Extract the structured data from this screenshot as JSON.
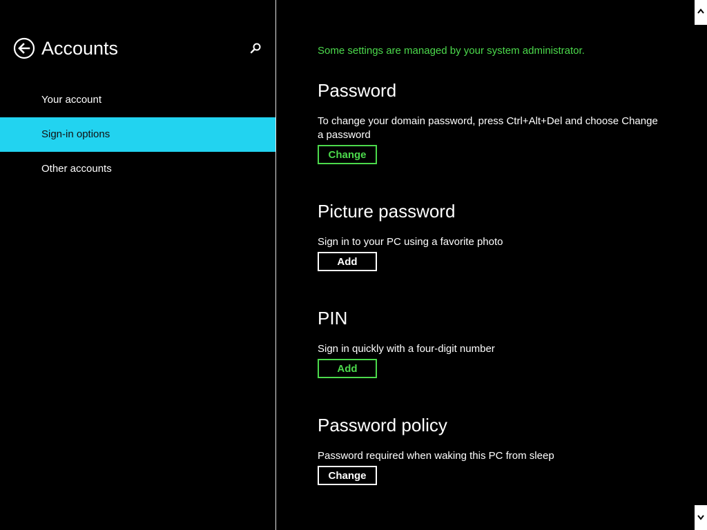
{
  "header": {
    "title": "Accounts",
    "back_icon": "back-arrow-icon",
    "search_icon": "search-icon"
  },
  "sidebar": {
    "items": [
      {
        "label": "Your account",
        "selected": false
      },
      {
        "label": "Sign-in options",
        "selected": true
      },
      {
        "label": "Other accounts",
        "selected": false
      }
    ]
  },
  "main": {
    "notice": "Some settings are managed by your system administrator.",
    "sections": [
      {
        "title": "Password",
        "description": "To change your domain password, press Ctrl+Alt+Del and choose Change a password",
        "button": "Change",
        "button_style": "green"
      },
      {
        "title": "Picture password",
        "description": "Sign in to your PC using a favorite photo",
        "button": "Add",
        "button_style": "white"
      },
      {
        "title": "PIN",
        "description": "Sign in quickly with a four-digit number",
        "button": "Add",
        "button_style": "green"
      },
      {
        "title": "Password policy",
        "description": "Password required when waking this PC from sleep",
        "button": "Change",
        "button_style": "white"
      }
    ]
  },
  "colors": {
    "accent": "#22d3f0",
    "managed_green": "#4cda4c",
    "background": "#000000",
    "text": "#ffffff"
  }
}
